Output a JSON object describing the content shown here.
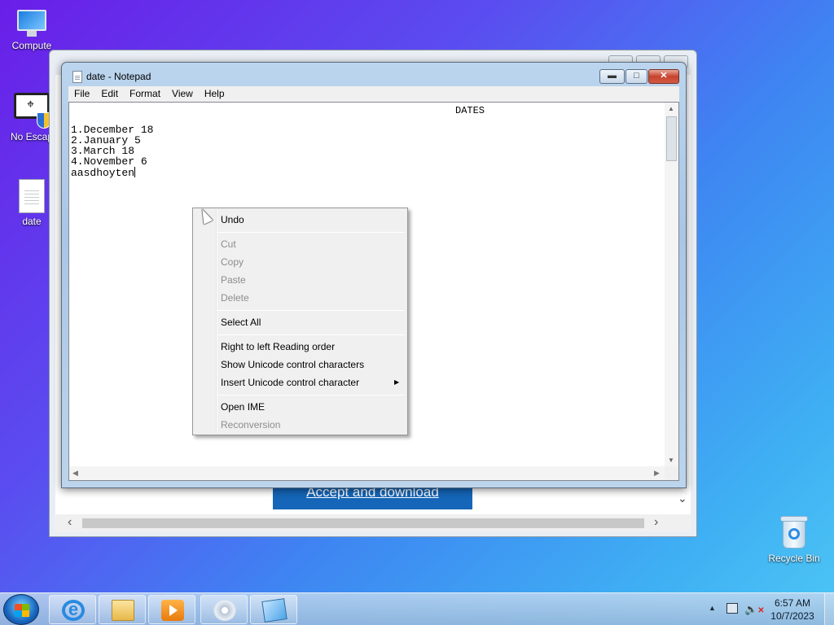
{
  "desktop": {
    "icons": [
      {
        "label": "Compute"
      },
      {
        "label": "No Escap"
      },
      {
        "label": "date"
      },
      {
        "label": "Recycle Bin"
      }
    ]
  },
  "browser": {
    "accept_button": "Accept and download"
  },
  "notepad": {
    "title": "date - Notepad",
    "menu": [
      "File",
      "Edit",
      "Format",
      "View",
      "Help"
    ],
    "heading": "DATES",
    "lines": [
      "1.December 18",
      "2.January 5",
      "3.March 18",
      "4.November 6",
      "aasdhoyten"
    ],
    "controls": {
      "minimize": "▬",
      "maximize": "□",
      "close": "✕"
    }
  },
  "context_menu": {
    "items": [
      {
        "label": "Undo",
        "enabled": true
      },
      {
        "label": "Cut",
        "enabled": false
      },
      {
        "label": "Copy",
        "enabled": false
      },
      {
        "label": "Paste",
        "enabled": false
      },
      {
        "label": "Delete",
        "enabled": false
      },
      {
        "label": "Select All",
        "enabled": true
      },
      {
        "label": "Right to left Reading order",
        "enabled": true
      },
      {
        "label": "Show Unicode control characters",
        "enabled": true
      },
      {
        "label": "Insert Unicode control character",
        "enabled": true,
        "submenu": true
      },
      {
        "label": "Open IME",
        "enabled": true
      },
      {
        "label": "Reconversion",
        "enabled": false
      }
    ]
  },
  "taskbar": {
    "clock_time": "6:57 AM",
    "clock_date": "10/7/2023",
    "pinned": [
      "internet-explorer-icon",
      "windows-explorer-icon",
      "media-player-icon",
      "disc-burner-icon",
      "notepad-icon"
    ]
  },
  "colors": {
    "accept_button": "#1566b8",
    "close_button": "#c7432e"
  }
}
